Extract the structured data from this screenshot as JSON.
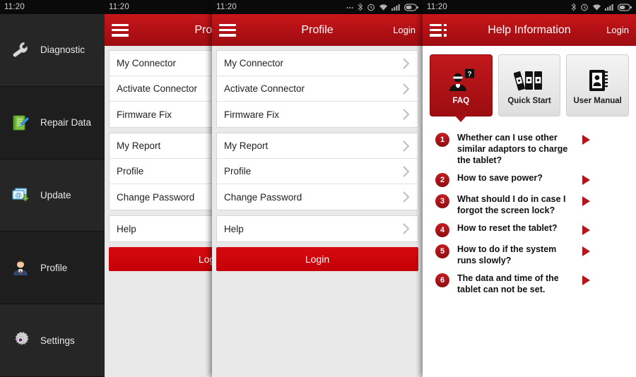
{
  "statusbar": {
    "time": "11:20",
    "icons": [
      "more-icon",
      "bluetooth-icon",
      "alarm-icon",
      "wifi-icon",
      "signal-icon",
      "battery-icon"
    ]
  },
  "sidebar": {
    "items": [
      {
        "label": "Diagnostic",
        "icon": "wrench-icon"
      },
      {
        "label": "Repair Data",
        "icon": "notebook-pen-icon"
      },
      {
        "label": "Update",
        "icon": "download-mail-icon"
      },
      {
        "label": "Profile",
        "icon": "person-icon"
      },
      {
        "label": "Settings",
        "icon": "gear-icon"
      }
    ]
  },
  "panel_back": {
    "title": "Profile",
    "menu_icon": "hamburger-icon",
    "login_link": "Login",
    "groups": [
      {
        "items": [
          "My Connector",
          "Activate Connector",
          "Firmware Fix"
        ]
      },
      {
        "items": [
          "My Report",
          "Profile",
          "Change Password"
        ]
      },
      {
        "items": [
          "Help"
        ]
      }
    ],
    "login_button": "Login"
  },
  "panel_front": {
    "title": "Profile",
    "menu_icon": "hamburger-icon",
    "login_link": "Login",
    "groups": [
      {
        "items": [
          "My Connector",
          "Activate Connector",
          "Firmware Fix"
        ]
      },
      {
        "items": [
          "My Report",
          "Profile",
          "Change Password"
        ]
      },
      {
        "items": [
          "Help"
        ]
      }
    ],
    "login_button": "Login"
  },
  "panel_help": {
    "title": "Help Information",
    "menu_icon": "list-menu-icon",
    "login_link": "Login",
    "tabs": [
      {
        "label": "FAQ",
        "icon": "faq-person-question-icon",
        "active": true
      },
      {
        "label": "Quick Start",
        "icon": "binders-icon",
        "active": false
      },
      {
        "label": "User Manual",
        "icon": "manual-book-icon",
        "active": false
      }
    ],
    "faq": [
      {
        "num": "1",
        "text": "Whether can I use other similar adaptors to charge the tablet?"
      },
      {
        "num": "2",
        "text": "How to save power?"
      },
      {
        "num": "3",
        "text": "What should I do in case I forgot the screen lock?"
      },
      {
        "num": "4",
        "text": "How to reset the tablet?"
      },
      {
        "num": "5",
        "text": "How to do if the system runs slowly?"
      },
      {
        "num": "6",
        "text": "The data and time of the tablet can not be set."
      }
    ],
    "arrow_icon": "play-arrow-icon"
  },
  "colors": {
    "brand_red": "#c0151a",
    "button_red": "#cc0006",
    "sidebar_dark": "#1e1e1e",
    "panel_bg": "#e9e9e9"
  }
}
